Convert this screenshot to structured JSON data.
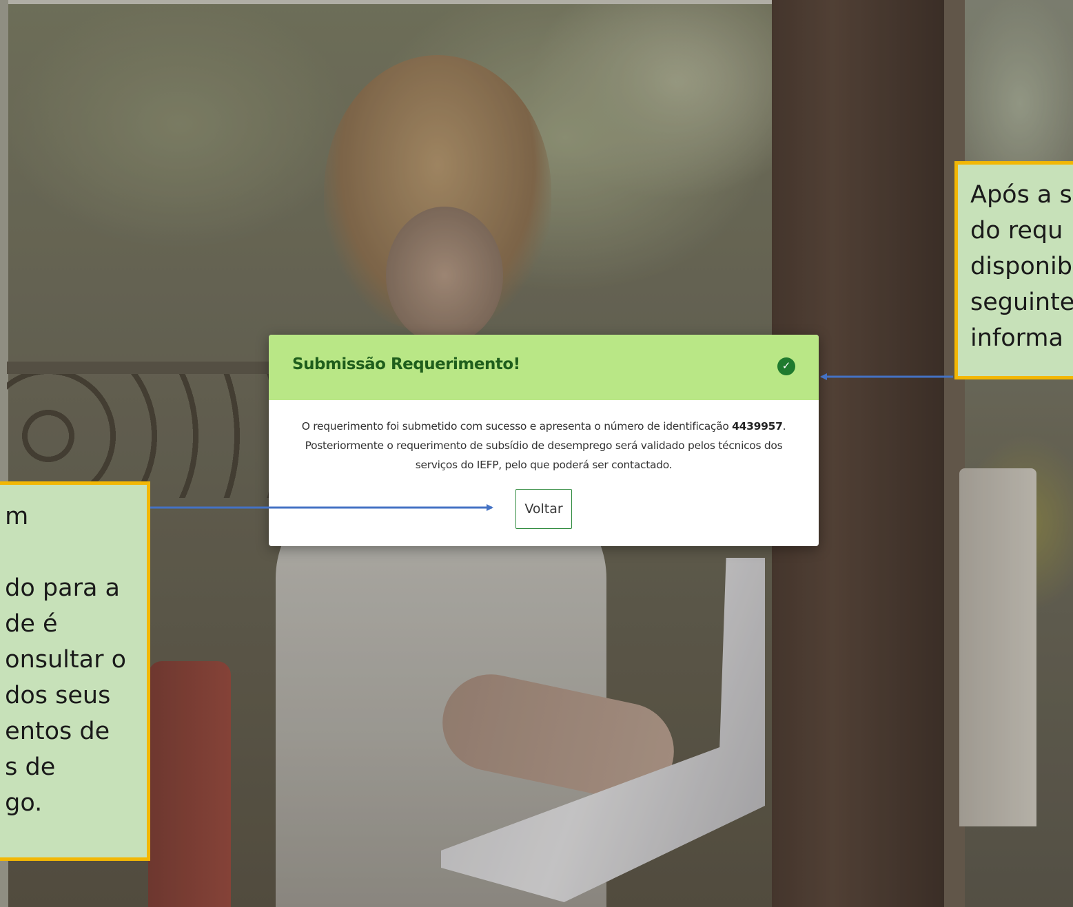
{
  "modal": {
    "title": "Submissão Requerimento!",
    "status_icon": "check-circle-icon",
    "message_part1": "O requerimento foi submetido com sucesso e apresenta o número de identificação ",
    "request_number": "4439957",
    "message_part2": ".",
    "message_line2": "Posteriormente o requerimento de subsídio de desemprego será validado pelos técnicos dos",
    "message_line3": "serviços do IEFP, pelo que poderá ser contactado.",
    "back_button_label": "Voltar"
  },
  "callouts": {
    "right_text": "Após a s\ndo requ\ndisponib\nseguinte\ninforma",
    "left_text": "m\n\ndo para a\nde é\nonsultar o\ndos seus\nentos de\ns de\ngo."
  },
  "colors": {
    "header_bg": "#b9e786",
    "title_color": "#1f5e1c",
    "check_icon": "#1f7a2e",
    "callout_bg": "#c7e1b9",
    "callout_border": "#f2b705",
    "arrow": "#4472c4"
  }
}
